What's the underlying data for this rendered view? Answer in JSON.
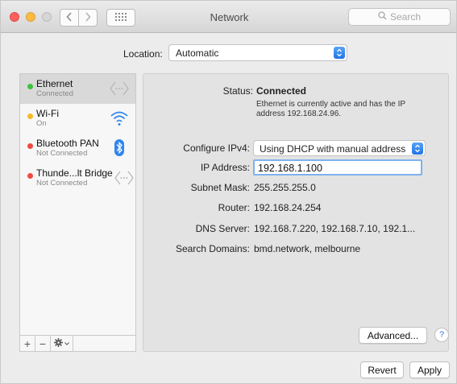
{
  "window": {
    "title": "Network",
    "search_placeholder": "Search"
  },
  "location": {
    "label": "Location:",
    "value": "Automatic"
  },
  "services": [
    {
      "name": "Ethernet",
      "status": "Connected",
      "dot_color": "#3ac33e",
      "icon": "ethernet-arrows-icon",
      "selected": true
    },
    {
      "name": "Wi-Fi",
      "status": "On",
      "dot_color": "#f4b82b",
      "icon": "wifi-icon",
      "selected": false
    },
    {
      "name": "Bluetooth PAN",
      "status": "Not Connected",
      "dot_color": "#f24a3f",
      "icon": "bluetooth-icon",
      "selected": false
    },
    {
      "name": "Thunde...lt Bridge",
      "status": "Not Connected",
      "dot_color": "#f24a3f",
      "icon": "ethernet-arrows-icon",
      "selected": false
    }
  ],
  "sidebar_tools": {
    "add": "+",
    "remove": "−"
  },
  "details": {
    "status_label": "Status:",
    "status_value": "Connected",
    "status_description": "Ethernet is currently active and has the IP address 192.168.24.96.",
    "configure_label": "Configure IPv4:",
    "configure_value": "Using DHCP with manual address",
    "ip_label": "IP Address:",
    "ip_value": "192.168.1.100",
    "subnet_label": "Subnet Mask:",
    "subnet_value": "255.255.255.0",
    "router_label": "Router:",
    "router_value": "192.168.24.254",
    "dns_label": "DNS Server:",
    "dns_value": "192.168.7.220, 192.168.7.10, 192.1...",
    "search_domains_label": "Search Domains:",
    "search_domains_value": "bmd.network, melbourne"
  },
  "buttons": {
    "advanced": "Advanced...",
    "help": "?",
    "revert": "Revert",
    "apply": "Apply"
  },
  "colors": {
    "accent": "#1f73e6",
    "focus_ring": "#7fb1ee",
    "selected_row": "#d9d9d9"
  }
}
